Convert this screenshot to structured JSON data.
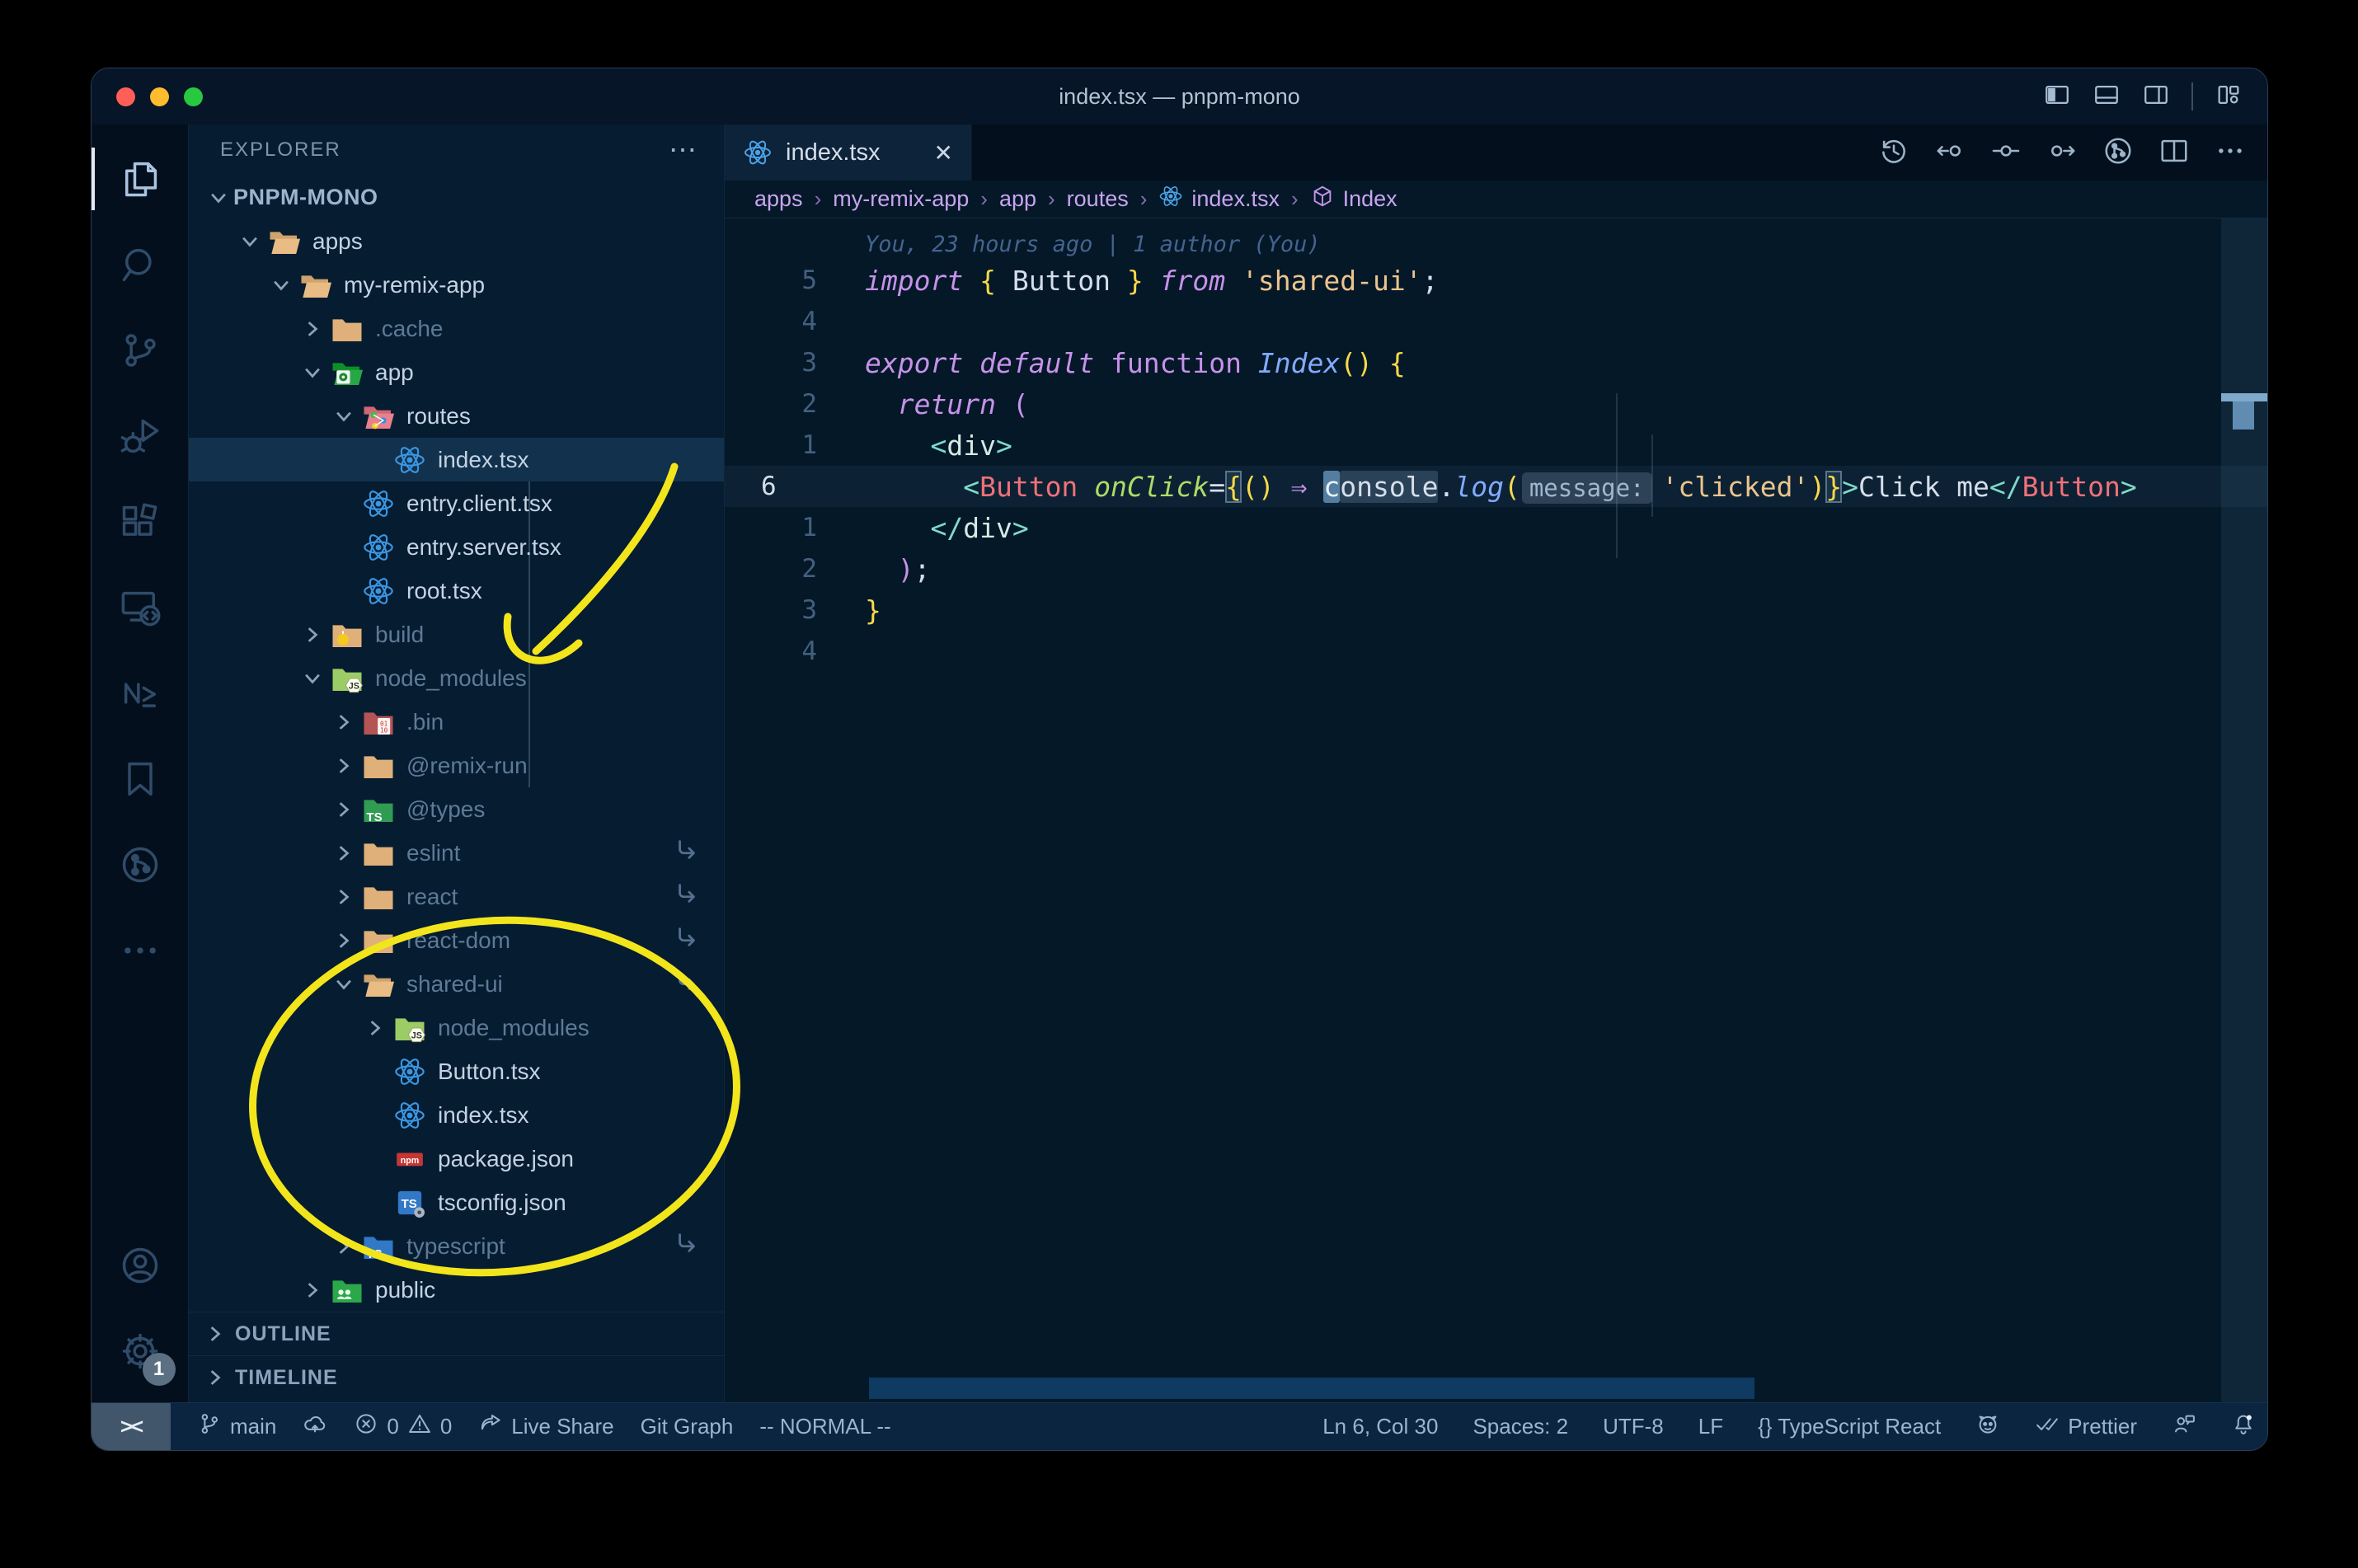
{
  "window": {
    "title": "index.tsx — pnpm-mono"
  },
  "titlebar_icons": [
    {
      "name": "toggle-primary-sidebar-icon"
    },
    {
      "name": "toggle-panel-icon"
    },
    {
      "name": "toggle-secondary-sidebar-icon"
    },
    {
      "name": "customize-layout-icon"
    }
  ],
  "activity_bar": {
    "top": [
      {
        "name": "explorer-icon",
        "icon": "files",
        "active": true
      },
      {
        "name": "search-icon",
        "icon": "search",
        "active": false
      },
      {
        "name": "source-control-icon",
        "icon": "scm",
        "active": false
      },
      {
        "name": "run-debug-icon",
        "icon": "debug",
        "active": false
      },
      {
        "name": "extensions-icon",
        "icon": "extensions",
        "active": false
      },
      {
        "name": "remote-explorer-icon",
        "icon": "remote",
        "active": false
      },
      {
        "name": "nx-console-icon",
        "icon": "nx",
        "active": false
      },
      {
        "name": "bookmarks-icon",
        "icon": "bookmark",
        "active": false
      },
      {
        "name": "git-graph-icon",
        "icon": "gitgraph",
        "active": false
      },
      {
        "name": "more-views-icon",
        "icon": "more",
        "active": false
      }
    ],
    "bottom": [
      {
        "name": "accounts-icon",
        "icon": "account",
        "active": false
      },
      {
        "name": "settings-icon",
        "icon": "gear",
        "active": false,
        "badge": "1"
      }
    ]
  },
  "sidebar": {
    "header": "EXPLORER",
    "more": "⋯",
    "tree": [
      {
        "label": "PNPM-MONO",
        "level": 0,
        "chev": "open",
        "icon": null,
        "root": true
      },
      {
        "label": "apps",
        "level": 1,
        "chev": "open",
        "icon": "folder-open-tan"
      },
      {
        "label": "my-remix-app",
        "level": 2,
        "chev": "open",
        "icon": "folder-open-tan"
      },
      {
        "label": ".cache",
        "level": 3,
        "chev": "closed",
        "icon": "folder-tan",
        "dim": true
      },
      {
        "label": "app",
        "level": 3,
        "chev": "open",
        "icon": "folder-app"
      },
      {
        "label": "routes",
        "level": 4,
        "chev": "open",
        "icon": "folder-routes"
      },
      {
        "label": "index.tsx",
        "level": 5,
        "chev": "none",
        "icon": "react",
        "selected": true
      },
      {
        "label": "entry.client.tsx",
        "level": 4,
        "chev": "none",
        "icon": "react"
      },
      {
        "label": "entry.server.tsx",
        "level": 4,
        "chev": "none",
        "icon": "react"
      },
      {
        "label": "root.tsx",
        "level": 4,
        "chev": "none",
        "icon": "react"
      },
      {
        "label": "build",
        "level": 3,
        "chev": "closed",
        "icon": "folder-build",
        "dim": true
      },
      {
        "label": "node_modules",
        "level": 3,
        "chev": "open",
        "icon": "folder-node",
        "dim": true
      },
      {
        "label": ".bin",
        "level": 4,
        "chev": "closed",
        "icon": "folder-bin",
        "dim": true
      },
      {
        "label": "@remix-run",
        "level": 4,
        "chev": "closed",
        "icon": "folder-tan",
        "dim": true
      },
      {
        "label": "@types",
        "level": 4,
        "chev": "closed",
        "icon": "folder-types",
        "dim": true
      },
      {
        "label": "eslint",
        "level": 4,
        "chev": "closed",
        "icon": "folder-tan",
        "dim": true,
        "link": true
      },
      {
        "label": "react",
        "level": 4,
        "chev": "closed",
        "icon": "folder-tan",
        "dim": true,
        "link": true
      },
      {
        "label": "react-dom",
        "level": 4,
        "chev": "closed",
        "icon": "folder-tan",
        "dim": true,
        "link": true
      },
      {
        "label": "shared-ui",
        "level": 4,
        "chev": "open",
        "icon": "folder-open-tan",
        "dim": true,
        "link": true
      },
      {
        "label": "node_modules",
        "level": 5,
        "chev": "closed",
        "icon": "folder-node",
        "dim": true
      },
      {
        "label": "Button.tsx",
        "level": 5,
        "chev": "none",
        "icon": "react"
      },
      {
        "label": "index.tsx",
        "level": 5,
        "chev": "none",
        "icon": "react"
      },
      {
        "label": "package.json",
        "level": 5,
        "chev": "none",
        "icon": "npm"
      },
      {
        "label": "tsconfig.json",
        "level": 5,
        "chev": "none",
        "icon": "tsconfig"
      },
      {
        "label": "typescript",
        "level": 4,
        "chev": "closed",
        "icon": "folder-ts",
        "dim": true,
        "link": true
      },
      {
        "label": "public",
        "level": 3,
        "chev": "closed",
        "icon": "folder-public"
      }
    ],
    "sections": [
      "OUTLINE",
      "TIMELINE"
    ]
  },
  "tabs": [
    {
      "label": "index.tsx",
      "icon": "react",
      "close": "✕",
      "active": true
    }
  ],
  "editor_actions": [
    {
      "name": "timeline-history-icon",
      "icon": "history"
    },
    {
      "name": "previous-change-icon",
      "icon": "prevchange"
    },
    {
      "name": "current-change-icon",
      "icon": "change"
    },
    {
      "name": "next-change-icon",
      "icon": "nextchange"
    },
    {
      "name": "git-graph-view-icon",
      "icon": "gitgraph"
    },
    {
      "name": "split-editor-icon",
      "icon": "split"
    },
    {
      "name": "more-actions-icon",
      "icon": "more"
    }
  ],
  "breadcrumbs": [
    {
      "label": "apps"
    },
    {
      "label": "my-remix-app"
    },
    {
      "label": "app"
    },
    {
      "label": "routes"
    },
    {
      "label": "index.tsx",
      "icon": "react"
    },
    {
      "label": "Index",
      "icon": "symbol-module"
    }
  ],
  "editor": {
    "blame": "You, 23 hours ago | 1 author (You)",
    "lines": [
      {
        "n": "5",
        "tokens": [
          [
            "import",
            "kw"
          ],
          [
            " ",
            "p"
          ],
          [
            "{",
            "b"
          ],
          [
            " Button ",
            "p"
          ],
          [
            "}",
            "b"
          ],
          [
            " ",
            "p"
          ],
          [
            "from",
            "kw"
          ],
          [
            " ",
            "p"
          ],
          [
            "'shared-ui'",
            "str"
          ],
          [
            ";",
            "p"
          ]
        ]
      },
      {
        "n": "4",
        "tokens": []
      },
      {
        "n": "3",
        "tokens": [
          [
            "export",
            "kw"
          ],
          [
            " ",
            "p"
          ],
          [
            "default",
            "kw"
          ],
          [
            " ",
            "p"
          ],
          [
            "function",
            "kw2"
          ],
          [
            " ",
            "p"
          ],
          [
            "Index",
            "fn"
          ],
          [
            "()",
            "b"
          ],
          [
            " ",
            "p"
          ],
          [
            "{",
            "b"
          ]
        ]
      },
      {
        "n": "2",
        "tokens": [
          [
            "  ",
            "p"
          ],
          [
            "return",
            "kw"
          ],
          [
            " ",
            "p"
          ],
          [
            "(",
            "paren"
          ]
        ]
      },
      {
        "n": "1",
        "tokens": [
          [
            "    ",
            "p"
          ],
          [
            "<",
            "tag"
          ],
          [
            "div",
            "name"
          ],
          [
            ">",
            "tag"
          ]
        ]
      },
      {
        "n": "6",
        "current": true,
        "tokens": [
          [
            "      ",
            "p"
          ],
          [
            "<",
            "tag"
          ],
          [
            "Button",
            "comp"
          ],
          [
            " ",
            "p"
          ],
          [
            "onClick",
            "attr"
          ],
          [
            "=",
            "p"
          ],
          [
            "{",
            "b bbox"
          ],
          [
            "()",
            "b"
          ],
          [
            " ",
            "p"
          ],
          [
            "⇒",
            "arrow"
          ],
          [
            " ",
            "p"
          ],
          [
            "c",
            "cursor"
          ],
          [
            "onsole",
            "p whl"
          ],
          [
            ".",
            "p"
          ],
          [
            "log",
            "fn"
          ],
          [
            "(",
            "b"
          ],
          [
            "message:",
            "inlay"
          ],
          [
            "'clicked'",
            "str"
          ],
          [
            ")",
            "b"
          ],
          [
            "}",
            "b bbox"
          ],
          [
            ">",
            "tag"
          ],
          [
            "Click me",
            "p"
          ],
          [
            "</",
            "tag"
          ],
          [
            "Button",
            "comp"
          ],
          [
            ">",
            "tag"
          ]
        ]
      },
      {
        "n": "1",
        "tokens": [
          [
            "    ",
            "p"
          ],
          [
            "</",
            "tag"
          ],
          [
            "div",
            "name"
          ],
          [
            ">",
            "tag"
          ]
        ]
      },
      {
        "n": "2",
        "tokens": [
          [
            "  ",
            "p"
          ],
          [
            ")",
            "paren"
          ],
          [
            ";",
            "p"
          ]
        ]
      },
      {
        "n": "3",
        "tokens": [
          [
            "}",
            "b"
          ]
        ]
      },
      {
        "n": "4",
        "tokens": []
      }
    ]
  },
  "status_bar": {
    "left": [
      {
        "name": "remote-indicator",
        "text": "><",
        "block": true
      },
      {
        "name": "git-branch",
        "icon": "branch",
        "text": "main"
      },
      {
        "name": "publish-icon",
        "icon": "cloud",
        "text": ""
      },
      {
        "name": "problems",
        "icon": "error",
        "text": "0",
        "icon2": "warning",
        "text2": "0"
      },
      {
        "name": "live-share",
        "icon": "share",
        "text": "Live Share"
      },
      {
        "name": "git-graph",
        "text": "Git Graph"
      },
      {
        "name": "vim-mode",
        "text": "-- NORMAL --"
      }
    ],
    "right": [
      {
        "name": "cursor-position",
        "text": "Ln 6, Col 30"
      },
      {
        "name": "indentation",
        "text": "Spaces: 2"
      },
      {
        "name": "encoding",
        "text": "UTF-8"
      },
      {
        "name": "eol",
        "text": "LF"
      },
      {
        "name": "language-mode",
        "text": "{} TypeScript React"
      },
      {
        "name": "github-icon",
        "icon": "octo",
        "text": ""
      },
      {
        "name": "prettier",
        "icon": "checks",
        "text": "Prettier"
      },
      {
        "name": "feedback-icon",
        "icon": "feedback",
        "text": ""
      },
      {
        "name": "notifications-icon",
        "icon": "bell",
        "text": ""
      }
    ]
  },
  "annotations": {
    "color": "#f2e51c"
  }
}
